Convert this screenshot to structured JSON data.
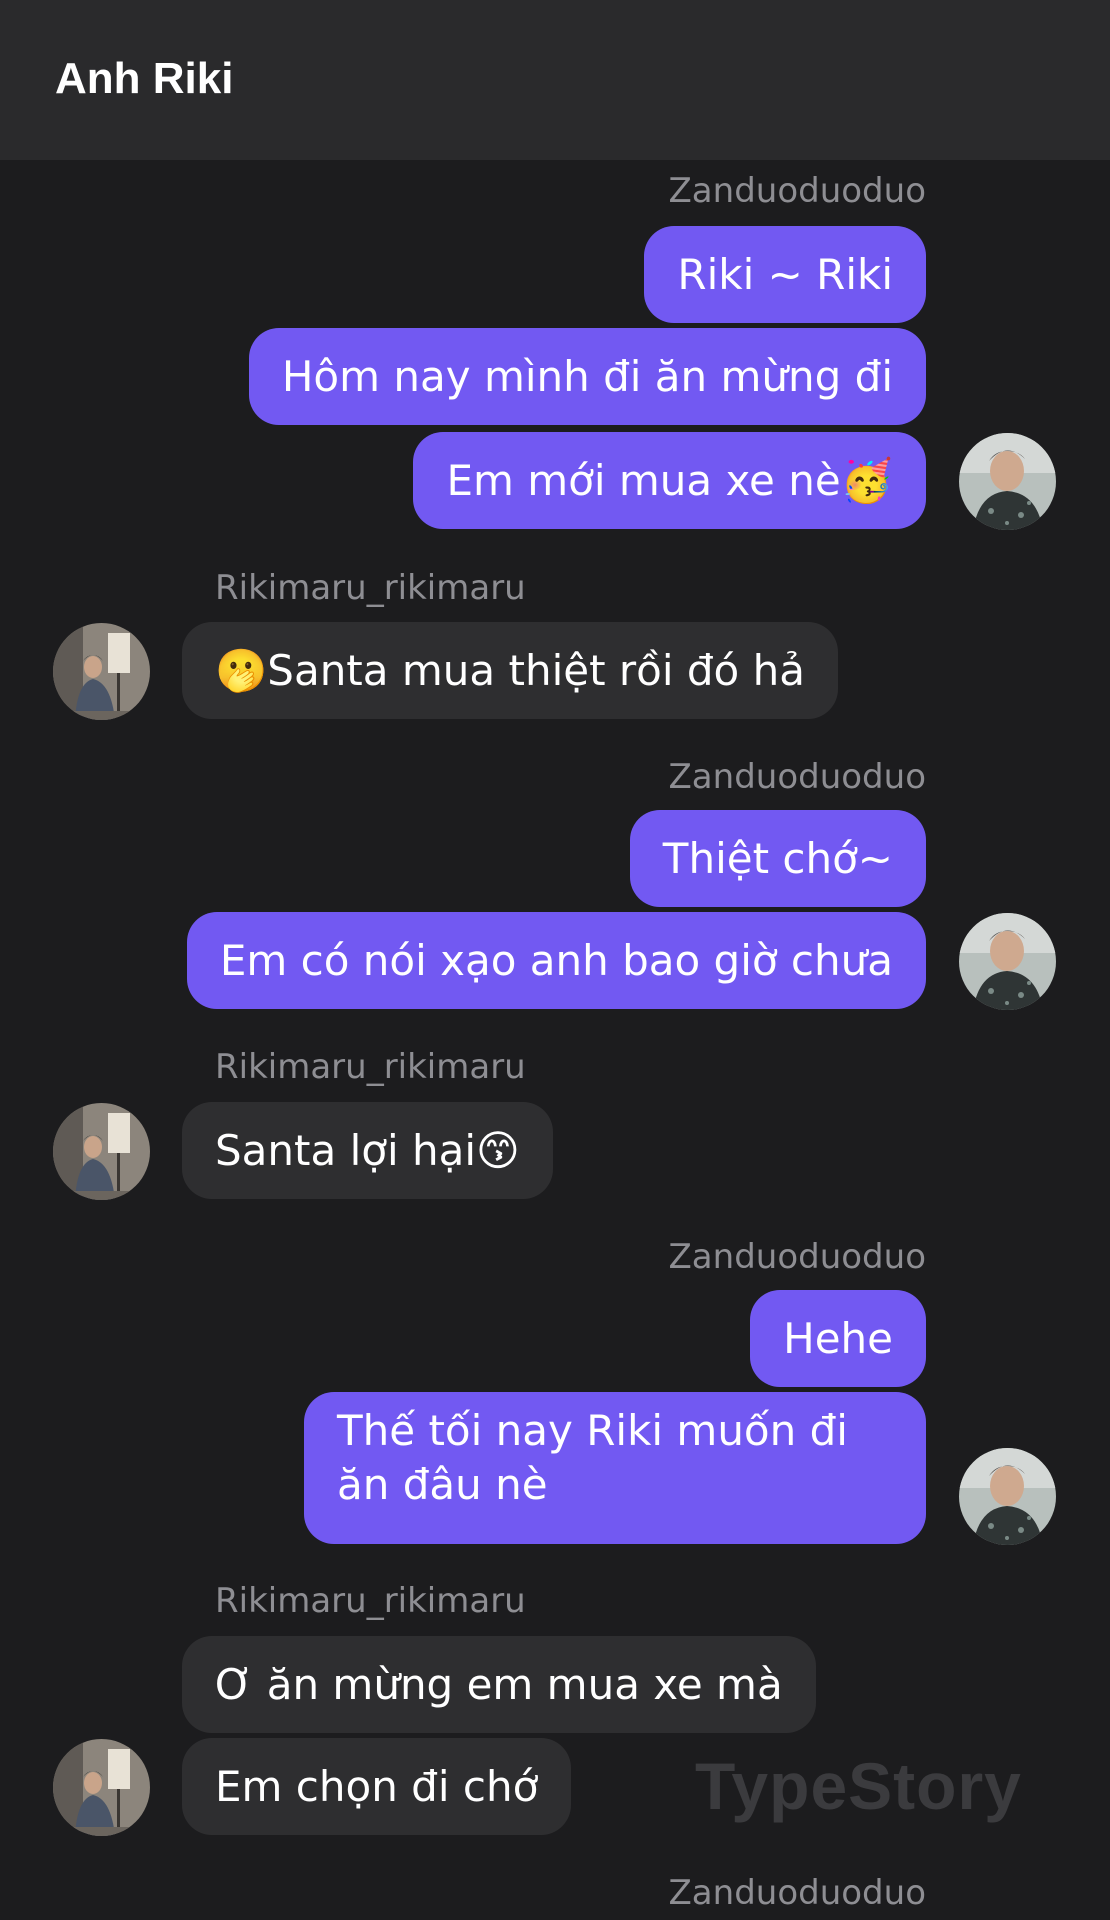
{
  "header": {
    "title": "Anh Riki"
  },
  "avatars": {
    "right_icon": "avatar-zanduoduoduo",
    "left_icon": "avatar-rikimaru"
  },
  "colors": {
    "outgoing_bubble": "#7259f2",
    "incoming_bubble": "#2e2e30",
    "background": "#1c1c1e",
    "header": "#2a2a2c"
  },
  "messages": [
    {
      "sender": "Zanduoduoduo",
      "texts": [
        "Riki ~ Riki",
        "Hôm nay mình đi ăn mừng đi",
        "Em mới mua xe nè🥳"
      ]
    },
    {
      "sender": "Rikimaru_rikimaru",
      "texts": [
        "🫢Santa mua thiệt rồi đó hả"
      ]
    },
    {
      "sender": "Zanduoduoduo",
      "texts": [
        "Thiệt chớ~",
        "Em có nói xạo anh bao giờ chưa"
      ]
    },
    {
      "sender": "Rikimaru_rikimaru",
      "texts": [
        "Santa lợi hại😙"
      ]
    },
    {
      "sender": "Zanduoduoduo",
      "texts": [
        "Hehe",
        "Thế tối nay Riki muốn đi ăn đâu nè"
      ]
    },
    {
      "sender": "Rikimaru_rikimaru",
      "texts": [
        "Ơ ăn mừng em mua xe mà",
        "Em chọn đi chớ"
      ]
    },
    {
      "sender": "Zanduoduoduo",
      "texts": []
    }
  ],
  "watermark": "TypeStory"
}
